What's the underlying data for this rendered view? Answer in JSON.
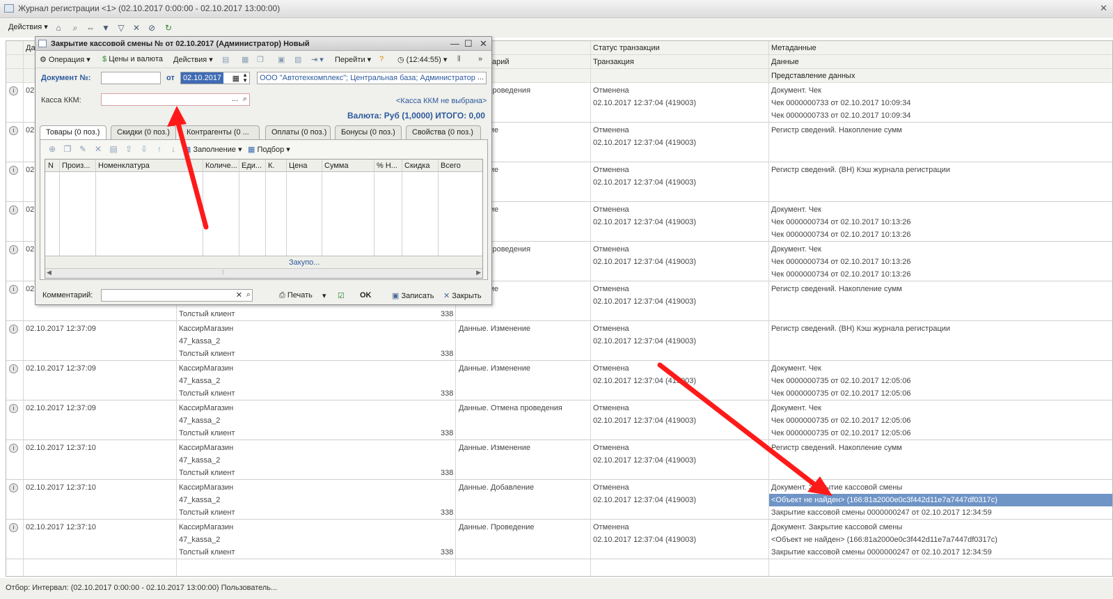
{
  "window": {
    "title": "Журнал регистрации <1> (02.10.2017 0:00:00 - 02.10.2017 13:00:00)"
  },
  "toolbar": {
    "actions_label": "Действия"
  },
  "grid": {
    "headers": {
      "date_partial": "Да",
      "comment_partial": "арий",
      "status": "Статус транзакции",
      "transaction": "Транзакция",
      "metadata": "Метаданные",
      "data": "Данные",
      "data_repr": "Представление данных"
    },
    "rows": [
      {
        "date": "02",
        "user": "",
        "computer": "",
        "session": "",
        "ev": "Отмена проведения",
        "status": "Отменена",
        "trans": "02.10.2017 12:37:04 (419003)",
        "meta": "Документ. Чек",
        "data": "Чек 0000000733 от 02.10.2017 10:09:34",
        "repr": "Чек 0000000733 от 02.10.2017 10:09:34"
      },
      {
        "date": "02",
        "user": "",
        "computer": "",
        "session": "",
        "ev": "Изменение",
        "status": "Отменена",
        "trans": "02.10.2017 12:37:04 (419003)",
        "meta": "Регистр сведений. Накопление сумм",
        "data": "",
        "repr": ""
      },
      {
        "date": "02",
        "user": "",
        "computer": "",
        "session": "",
        "ev": "Изменение",
        "status": "Отменена",
        "trans": "02.10.2017 12:37:04 (419003)",
        "meta": "Регистр сведений. (ВН) Кэш журнала регистрации",
        "data": "",
        "repr": ""
      },
      {
        "date": "02",
        "user": "",
        "computer": "",
        "session": "",
        "ev": "Изменение",
        "status": "Отменена",
        "trans": "02.10.2017 12:37:04 (419003)",
        "meta": "Документ. Чек",
        "data": "Чек 0000000734 от 02.10.2017 10:13:26",
        "repr": "Чек 0000000734 от 02.10.2017 10:13:26"
      },
      {
        "date": "02",
        "user": "",
        "computer": "",
        "session": "",
        "ev": "Отмена проведения",
        "status": "Отменена",
        "trans": "02.10.2017 12:37:04 (419003)",
        "meta": "Документ. Чек",
        "data": "Чек 0000000734 от 02.10.2017 10:13:26",
        "repr": "Чек 0000000734 от 02.10.2017 10:13:26"
      },
      {
        "date": "02",
        "user": "",
        "computer": "",
        "session": "Толстый клиент",
        "sess_num": "338",
        "ev": "Изменение",
        "status": "Отменена",
        "trans": "02.10.2017 12:37:04 (419003)",
        "meta": "Регистр сведений. Накопление сумм",
        "data": "",
        "repr": ""
      },
      {
        "date": "02.10.2017 12:37:09",
        "user": "КассирМагазин",
        "computer": "47_kassa_2",
        "session": "Толстый клиент",
        "sess_num": "338",
        "ev": "Данные. Изменение",
        "status": "Отменена",
        "trans": "02.10.2017 12:37:04 (419003)",
        "meta": "Регистр сведений. (ВН) Кэш журнала регистрации",
        "data": "",
        "repr": ""
      },
      {
        "date": "02.10.2017 12:37:09",
        "user": "КассирМагазин",
        "computer": "47_kassa_2",
        "session": "Толстый клиент",
        "sess_num": "338",
        "ev": "Данные. Изменение",
        "status": "Отменена",
        "trans": "02.10.2017 12:37:04 (419003)",
        "meta": "Документ. Чек",
        "data": "Чек 0000000735 от 02.10.2017 12:05:06",
        "repr": "Чек 0000000735 от 02.10.2017 12:05:06"
      },
      {
        "date": "02.10.2017 12:37:09",
        "user": "КассирМагазин",
        "computer": "47_kassa_2",
        "session": "Толстый клиент",
        "sess_num": "338",
        "ev": "Данные. Отмена проведения",
        "status": "Отменена",
        "trans": "02.10.2017 12:37:04 (419003)",
        "meta": "Документ. Чек",
        "data": "Чек 0000000735 от 02.10.2017 12:05:06",
        "repr": "Чек 0000000735 от 02.10.2017 12:05:06"
      },
      {
        "date": "02.10.2017 12:37:10",
        "user": "КассирМагазин",
        "computer": "47_kassa_2",
        "session": "Толстый клиент",
        "sess_num": "338",
        "ev": "Данные. Изменение",
        "status": "Отменена",
        "trans": "02.10.2017 12:37:04 (419003)",
        "meta": "Регистр сведений. Накопление сумм",
        "data": "",
        "repr": ""
      },
      {
        "date": "02.10.2017 12:37:10",
        "user": "КассирМагазин",
        "computer": "47_kassa_2",
        "session": "Толстый клиент",
        "sess_num": "338",
        "ev": "Данные. Добавление",
        "status": "Отменена",
        "trans": "02.10.2017 12:37:04 (419003)",
        "meta": "Документ. Закрытие кассовой смены",
        "data": "<Объект не найден> (166:81a2000e0c3f442d11e7a7447df0317c)",
        "repr": "Закрытие кассовой смены 0000000247 от 02.10.2017 12:34:59"
      },
      {
        "date": "02.10.2017 12:37:10",
        "user": "КассирМагазин",
        "computer": "47_kassa_2",
        "session": "Толстый клиент",
        "sess_num": "338",
        "ev": "Данные. Проведение",
        "status": "Отменена",
        "trans": "02.10.2017 12:37:04 (419003)",
        "meta": "Документ. Закрытие кассовой смены",
        "data": "<Объект не найден> (166:81a2000e0c3f442d11e7a7447df0317c)",
        "repr": "Закрытие кассовой смены 0000000247 от 02.10.2017 12:34:59"
      }
    ]
  },
  "statusbar": {
    "text": "Отбор:   Интервал: (02.10.2017 0:00:00 - 02.10.2017 13:00:00)  Пользователь..."
  },
  "modal": {
    "title": "Закрытие кассовой смены №  от 02.10.2017 (Администратор) Новый",
    "toolbar": {
      "operation": "Операция",
      "prices": "Цены и валюта",
      "actions": "Действия",
      "goto": "Перейти",
      "time": "(12:44:55)"
    },
    "doc_label": "Документ №:",
    "doc_number": "",
    "from_label": "от",
    "date_value": "02.10.2017",
    "org_value": "ООО \"Автотехкомплекс\"; Центральная база; Администратор",
    "kkm_label": "Касса ККМ:",
    "kkm_value": "",
    "kkm_link": "<Касса ККМ не выбрана>",
    "currency_total": "Валюта: Руб (1,0000) ИТОГО: 0,00",
    "tabs": [
      "Товары (0 поз.)",
      "Скидки (0 поз.)",
      "Контрагенты (0 ...",
      "Оплаты (0 поз.)",
      "Бонусы (0 поз.)",
      "Свойства (0 поз.)"
    ],
    "table_toolbar": {
      "fill": "Заполнение",
      "pick": "Подбор"
    },
    "table_headers": [
      "N",
      "Произ...",
      "Номенклатура",
      "Количе...",
      "Еди...",
      "К.",
      "Цена",
      "Сумма",
      "% Н...",
      "Скидка",
      "Всего"
    ],
    "table_footer_text": "Закупо...",
    "comment_label": "Комментарий:",
    "comment_value": "",
    "print_label": "Печать",
    "ok_label": "OK",
    "save_label": "Записать",
    "close_label": "Закрыть"
  },
  "colors": {
    "selection": "#6f94c6",
    "arrow": "#ff1a1a",
    "link": "#2c5a9c"
  }
}
